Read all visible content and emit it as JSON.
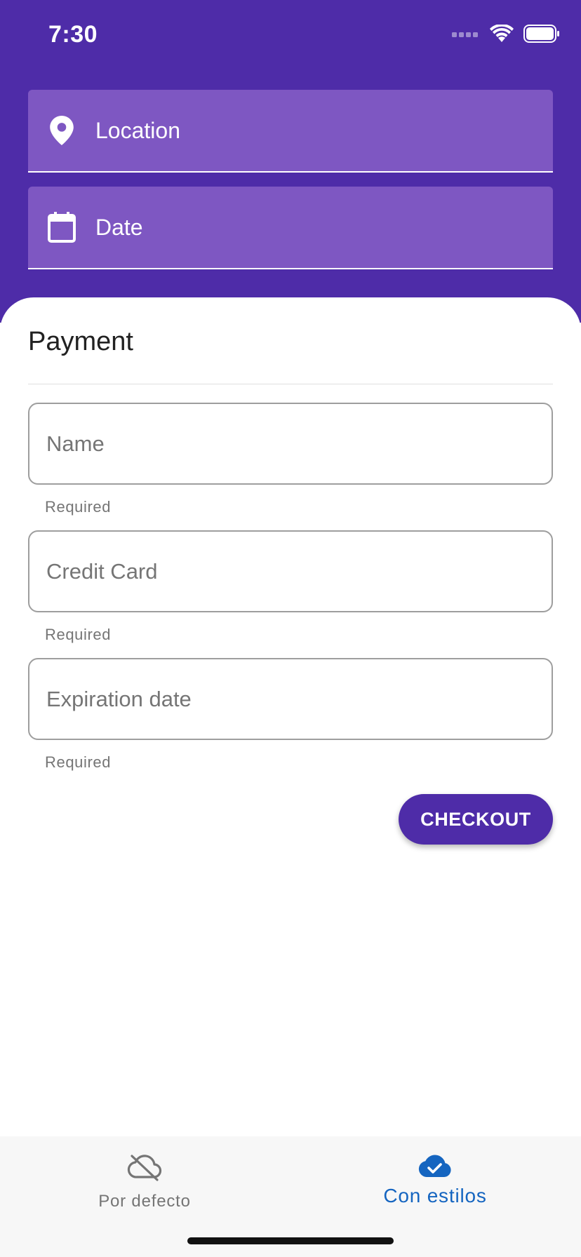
{
  "status_bar": {
    "time": "7:30",
    "icons": [
      "signal-dots-icon",
      "wifi-icon",
      "battery-icon"
    ]
  },
  "header_fields": [
    {
      "label": "Location",
      "icon": "location-pin-icon"
    },
    {
      "label": "Date",
      "icon": "calendar-icon"
    }
  ],
  "payment": {
    "title": "Payment",
    "fields": [
      {
        "placeholder": "Name",
        "helper": "Required"
      },
      {
        "placeholder": "Credit Card",
        "helper": "Required"
      },
      {
        "placeholder": "Expiration date",
        "helper": "Required"
      }
    ],
    "checkout_label": "CHECKOUT"
  },
  "bottom_nav": {
    "items": [
      {
        "label": "Por defecto",
        "icon": "cloud-off-icon",
        "active": false
      },
      {
        "label": "Con estilos",
        "icon": "cloud-done-icon",
        "active": true
      }
    ]
  },
  "colors": {
    "primary": "#4E2CA8",
    "field_fill": "#7E57C2",
    "nav_active": "#1565C0",
    "nav_inactive": "#757575"
  }
}
